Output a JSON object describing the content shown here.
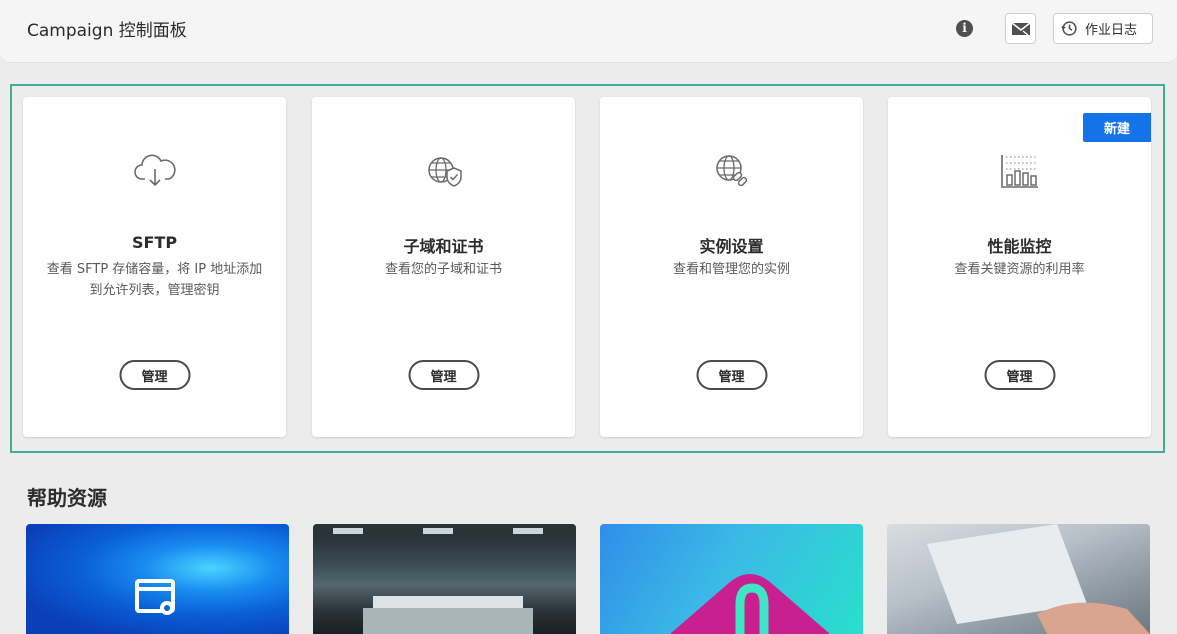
{
  "header": {
    "title": "Campaign 控制面板",
    "info_glyph": "i",
    "mail_icon": "mail-icon",
    "joblog_label": "作业日志"
  },
  "cards": [
    {
      "icon": "cloud-download-icon",
      "title": "SFTP",
      "desc": "查看 SFTP 存储容量，将 IP 地址添加到允许列表，管理密钥",
      "button": "管理"
    },
    {
      "icon": "globe-shield-icon",
      "title": "子域和证书",
      "desc": "查看您的子域和证书",
      "button": "管理"
    },
    {
      "icon": "globe-link-icon",
      "title": "实例设置",
      "desc": "查看和管理您的实例",
      "button": "管理"
    },
    {
      "icon": "bar-chart-icon",
      "title": "性能监控",
      "desc": "查看关键资源的利用率",
      "button": "管理",
      "badge": "新建"
    }
  ],
  "help": {
    "title": "帮助资源"
  },
  "colors": {
    "accent": "#1473e6",
    "highlight": "#3fae93"
  }
}
